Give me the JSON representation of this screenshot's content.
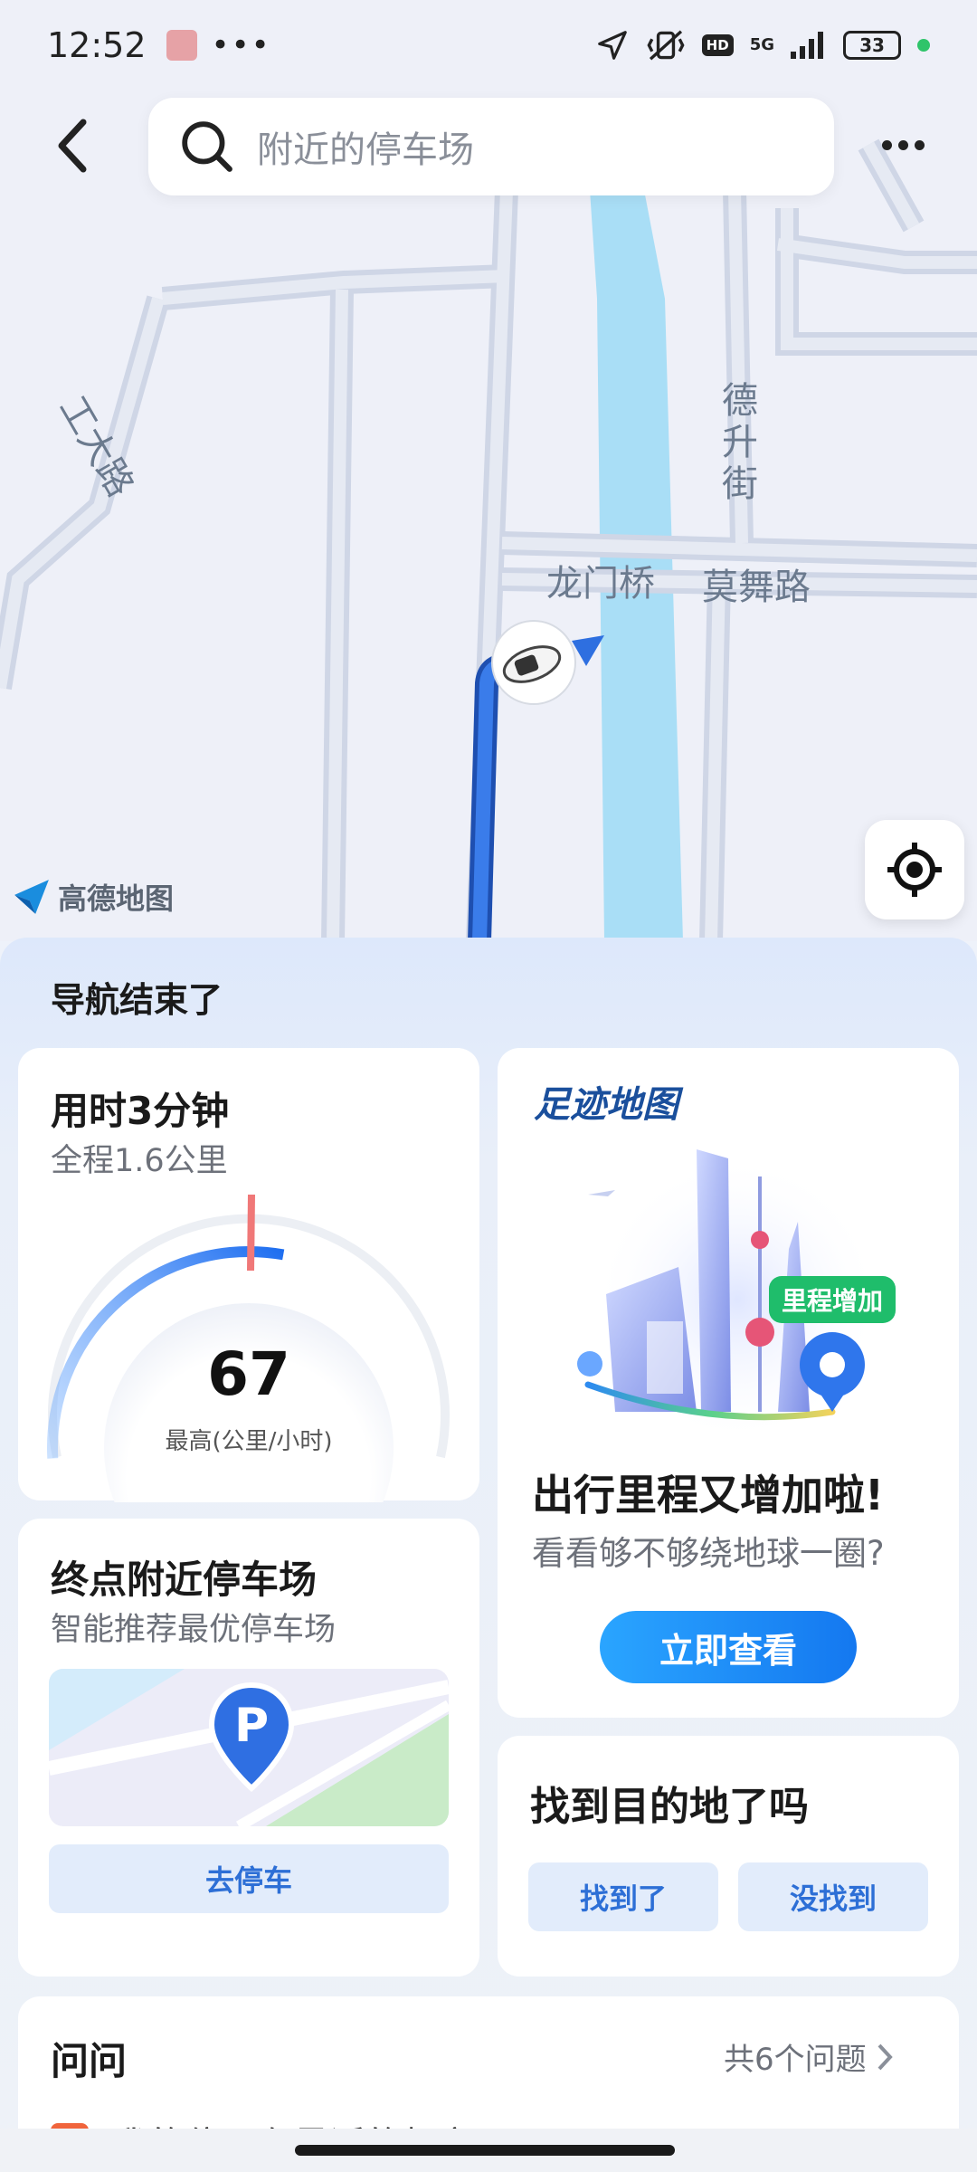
{
  "status_bar": {
    "time": "12:52",
    "dots": "•••",
    "hd": "HD",
    "network": "5G",
    "battery": "33"
  },
  "search": {
    "placeholder": "附近的停车场"
  },
  "map": {
    "road_labels": [
      "工大路",
      "德升街",
      "龙门桥",
      "莫舞路"
    ],
    "brand": "高德地图"
  },
  "sheet": {
    "title": "导航结束了"
  },
  "speed_card": {
    "duration": "用时3分钟",
    "distance": "全程1.6公里",
    "max_speed": "67",
    "max_speed_label": "最高(公里/小时)",
    "gauge_max": 120
  },
  "footprint_card": {
    "logo": "足迹地图",
    "badge": "里程增加",
    "headline": "出行里程又增加啦!",
    "subtitle": "看看够不够绕地球一圈?",
    "button": "立即查看"
  },
  "parking_card": {
    "title": "终点附近停车场",
    "subtitle": "智能推荐最优停车场",
    "button": "去停车"
  },
  "destination_card": {
    "title": "找到目的地了吗",
    "yes": "找到了",
    "no": "没找到"
  },
  "ask_card": {
    "title": "问问",
    "count": "共6个问题",
    "first_question": "我的位置有最近的超市吗"
  },
  "colors": {
    "accent": "#1478f0",
    "route": "#2f6fd9",
    "river": "#a9def6",
    "green": "#1fbd6b"
  }
}
